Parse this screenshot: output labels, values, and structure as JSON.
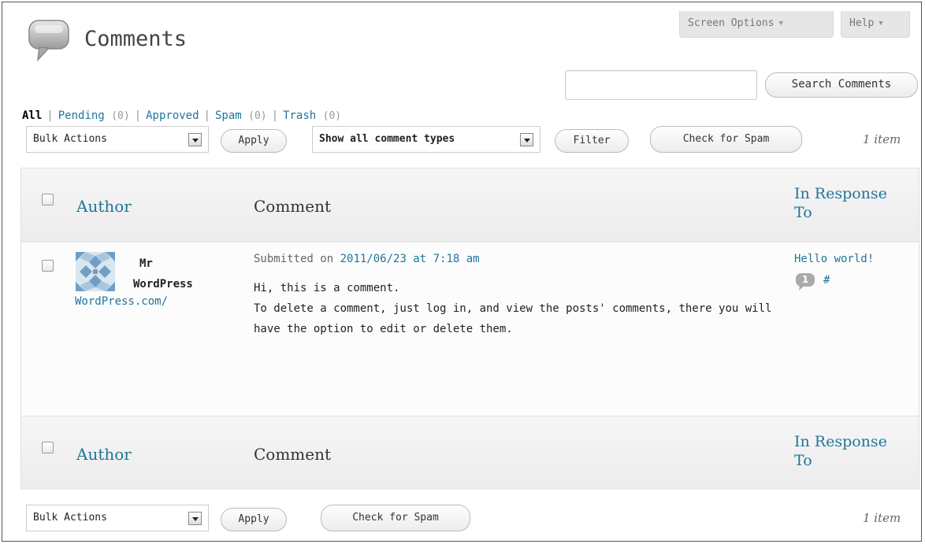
{
  "header": {
    "title": "Comments",
    "screen_options": "Screen Options",
    "help": "Help"
  },
  "filters": {
    "all": "All",
    "pending": "Pending",
    "pending_count": "(0)",
    "approved": "Approved",
    "spam": "Spam",
    "spam_count": "(0)",
    "trash": "Trash",
    "trash_count": "(0)",
    "separator": "|"
  },
  "search": {
    "value": "",
    "button": "Search Comments"
  },
  "toolbar_top": {
    "bulk_actions": "Bulk Actions",
    "apply": "Apply",
    "comment_type": "Show all comment types",
    "filter": "Filter",
    "check_spam": "Check for Spam",
    "count": "1 item"
  },
  "table": {
    "columns": {
      "author": "Author",
      "comment": "Comment",
      "response_line1": "In Response",
      "response_line2": "To"
    },
    "rows": [
      {
        "author_line1": "Mr",
        "author_line2": "WordPress",
        "author_url": "WordPress.com/",
        "submitted_prefix": "Submitted on",
        "date_link": "2011/06/23 at 7:18 am",
        "comment_line1": "Hi, this is a comment.",
        "comment_line2": "To delete a comment, just log in, and view the posts' comments, there you will have the option to edit or delete them.",
        "response_title": "Hello world!",
        "response_count": "1",
        "response_hash": "#"
      }
    ]
  },
  "toolbar_bottom": {
    "bulk_actions": "Bulk Actions",
    "apply": "Apply",
    "check_spam": "Check for Spam",
    "count": "1 item"
  },
  "colors": {
    "link": "#21759b",
    "header_bg": "#ececec"
  }
}
